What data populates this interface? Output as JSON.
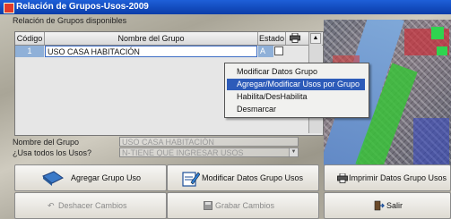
{
  "window": {
    "title": "Relación de Grupos-Usos-2009"
  },
  "grid": {
    "section_label": "Relación de Grupos disponibles",
    "columns": {
      "codigo": "Código",
      "nombre": "Nombre del Grupo",
      "estado": "Estado"
    },
    "rows": [
      {
        "codigo": "1",
        "nombre": "USO CASA HABITACIÓN",
        "estado": "A"
      }
    ]
  },
  "context_menu": {
    "items": [
      {
        "label": "Modificar Datos Grupo"
      },
      {
        "label": "Agregar/Modificar Usos por Grupo"
      },
      {
        "label": "Habilita/DesHabilita"
      },
      {
        "label": "Desmarcar"
      }
    ],
    "selected_index": 1
  },
  "form": {
    "nombre_label": "Nombre del Grupo",
    "nombre_value": "USO CASA HABITACIÓN",
    "usos_label": "¿Usa todos los Usos?",
    "usos_value": "N-TIENE QUE INGRESAR USOS"
  },
  "buttons": {
    "agregar": "Agregar Grupo Uso",
    "modificar": "Modificar Datos Grupo Usos",
    "imprimir": "Imprimir Datos Grupo  Usos",
    "deshacer": "Deshacer Cambios",
    "grabar": "Grabar Cambios",
    "salir": "Salir"
  },
  "colors": {
    "title_bar": "#0a3ca8",
    "selection": "#2d5bb9"
  }
}
